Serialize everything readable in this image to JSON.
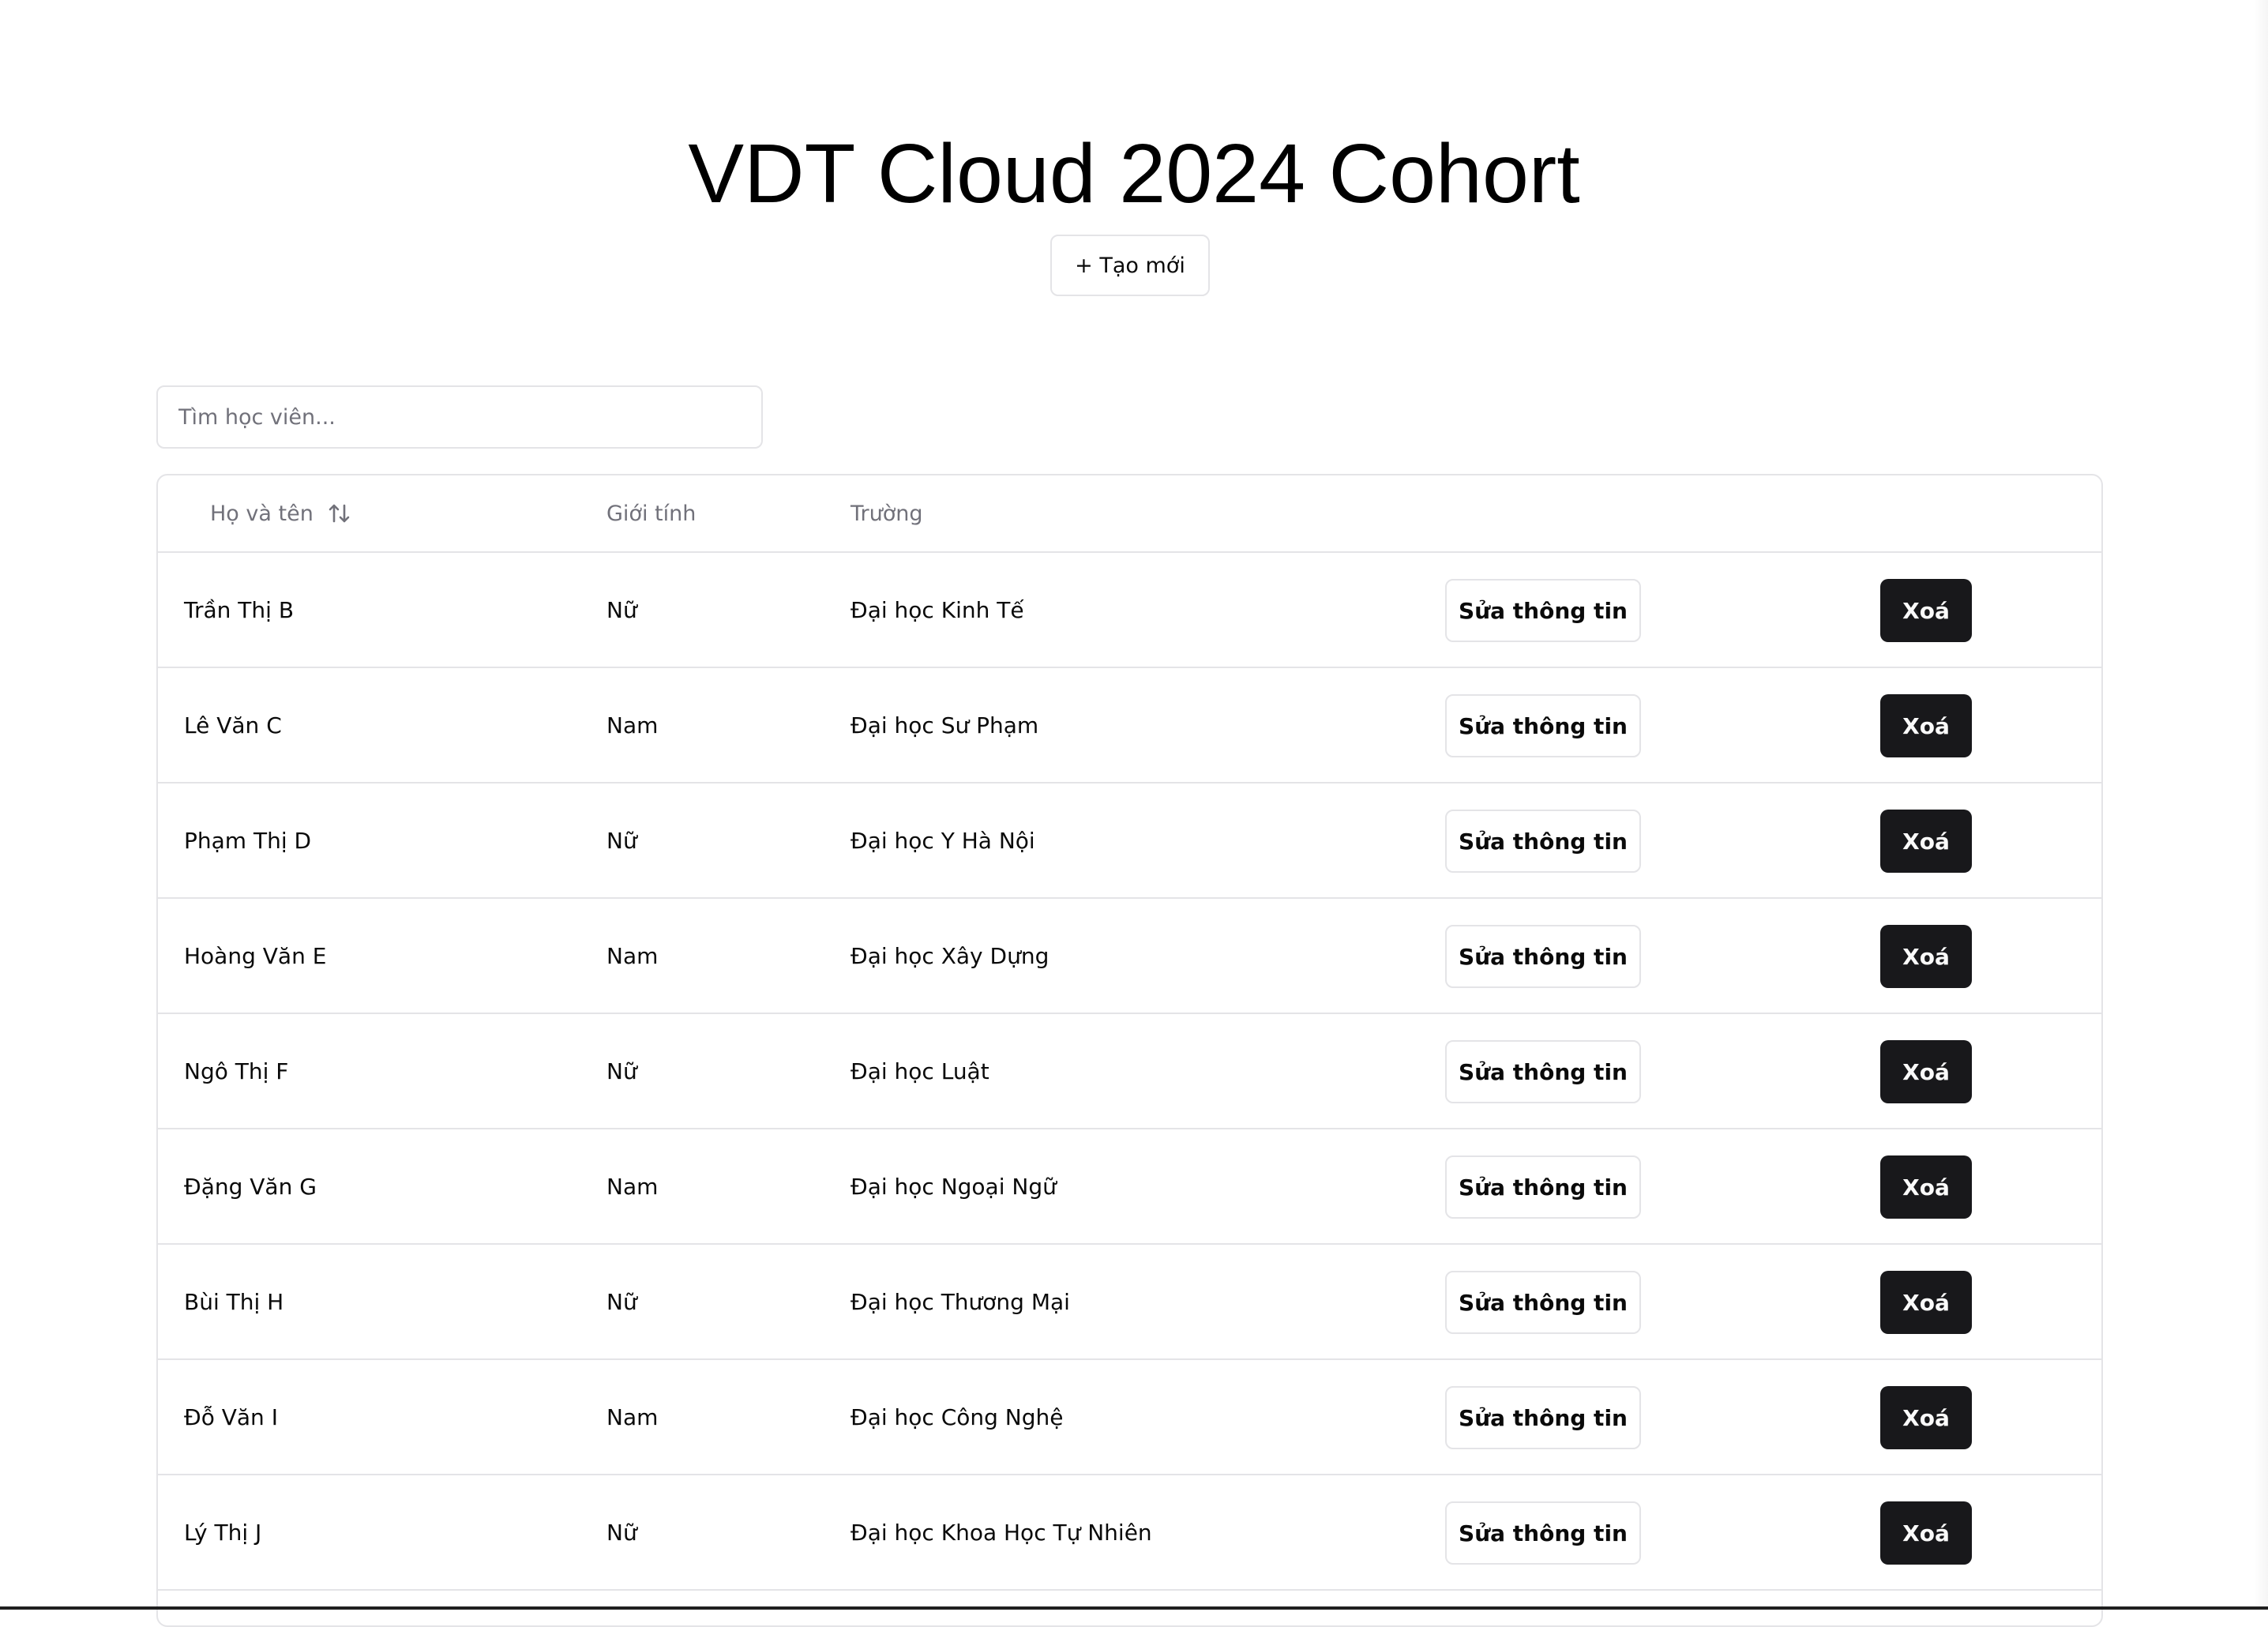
{
  "page": {
    "title": "VDT Cloud 2024 Cohort",
    "create_label": "+ Tạo mới"
  },
  "search": {
    "placeholder": "Tìm học viên..."
  },
  "table": {
    "headers": {
      "name": "Họ và tên",
      "gender": "Giới tính",
      "school": "Trường"
    },
    "sort_icon": "arrow-up-down-icon",
    "edit_label": "Sửa thông tin",
    "delete_label": "Xoá",
    "rows": [
      {
        "name": "Trần Thị B",
        "gender": "Nữ",
        "school": "Đại học Kinh Tế"
      },
      {
        "name": "Lê Văn C",
        "gender": "Nam",
        "school": "Đại học Sư Phạm"
      },
      {
        "name": "Phạm Thị D",
        "gender": "Nữ",
        "school": "Đại học Y Hà Nội"
      },
      {
        "name": "Hoàng Văn E",
        "gender": "Nam",
        "school": "Đại học Xây Dựng"
      },
      {
        "name": "Ngô Thị F",
        "gender": "Nữ",
        "school": "Đại học Luật"
      },
      {
        "name": "Đặng Văn G",
        "gender": "Nam",
        "school": "Đại học Ngoại Ngữ"
      },
      {
        "name": "Bùi Thị H",
        "gender": "Nữ",
        "school": "Đại học Thương Mại"
      },
      {
        "name": "Đỗ Văn I",
        "gender": "Nam",
        "school": "Đại học Công Nghệ"
      },
      {
        "name": "Lý Thị J",
        "gender": "Nữ",
        "school": "Đại học Khoa Học Tự Nhiên"
      }
    ]
  },
  "colors": {
    "border": "#e4e4e7",
    "muted_text": "#71717a",
    "primary_button": "#18181b",
    "primary_button_text": "#fafafa"
  }
}
